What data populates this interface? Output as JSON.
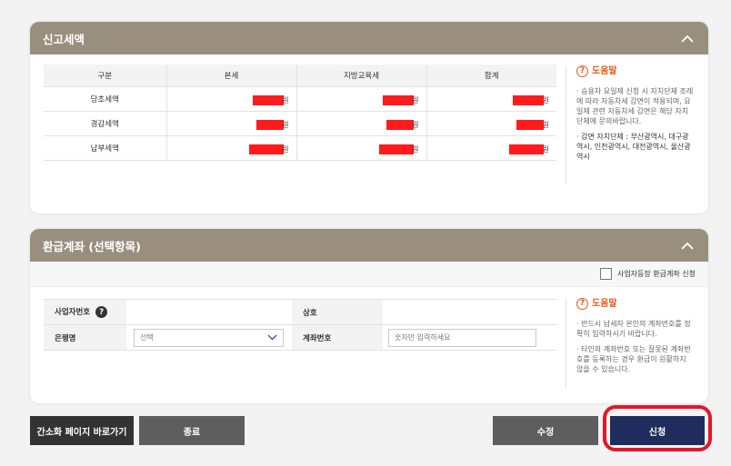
{
  "tax_section": {
    "title": "신고세액",
    "headers": [
      "구분",
      "본세",
      "지방교육세",
      "합계"
    ],
    "rows": [
      {
        "label": "당초세액",
        "unit": "원"
      },
      {
        "label": "경감세액",
        "unit": "원"
      },
      {
        "label": "납부세액",
        "unit": "원"
      }
    ],
    "help": {
      "title": "도움말",
      "note1": "· 승용차 요일제 신청 시 자치단체 조례에 따라 자동차세 감면이 적용되며, 요일제 관련 자동차세 감면은 해당 자치단체에 문의바랍니다.",
      "note2": "· 감면 자치단체 : 부산광역시, 대구광역시, 인천광역시, 대전광역시, 울산광역시"
    }
  },
  "refund_section": {
    "title": "환급계좌 (선택항목)",
    "business_refund_checkbox": "사업자등장 환급계좌 신청",
    "labels": {
      "business_number": "사업자번호",
      "trade_name": "상호",
      "bank_name": "은행명",
      "account_number": "계좌번호"
    },
    "bank_select_value": "선택",
    "account_placeholder": "숫자만 입력하세요",
    "help": {
      "title": "도움말",
      "note1": "· 반드시 납세자 본인의 계좌번호를 정확히 입력하시기 바랍니다.",
      "note2": "· 타인의 계좌번호 또는 잘못된 계좌번호를 등록하는 경우 환급이 원활하지 않을 수 있습니다."
    }
  },
  "buttons": {
    "simple_page": "간소화 페이지 바로가기",
    "close": "종료",
    "edit": "수정",
    "apply": "신청"
  },
  "colors": {
    "header_bg": "#9a8f7f",
    "help_accent": "#e85a1b",
    "redaction": "#ff1b1b",
    "apply_button": "#1f2d5c",
    "highlight": "#e3162b"
  }
}
